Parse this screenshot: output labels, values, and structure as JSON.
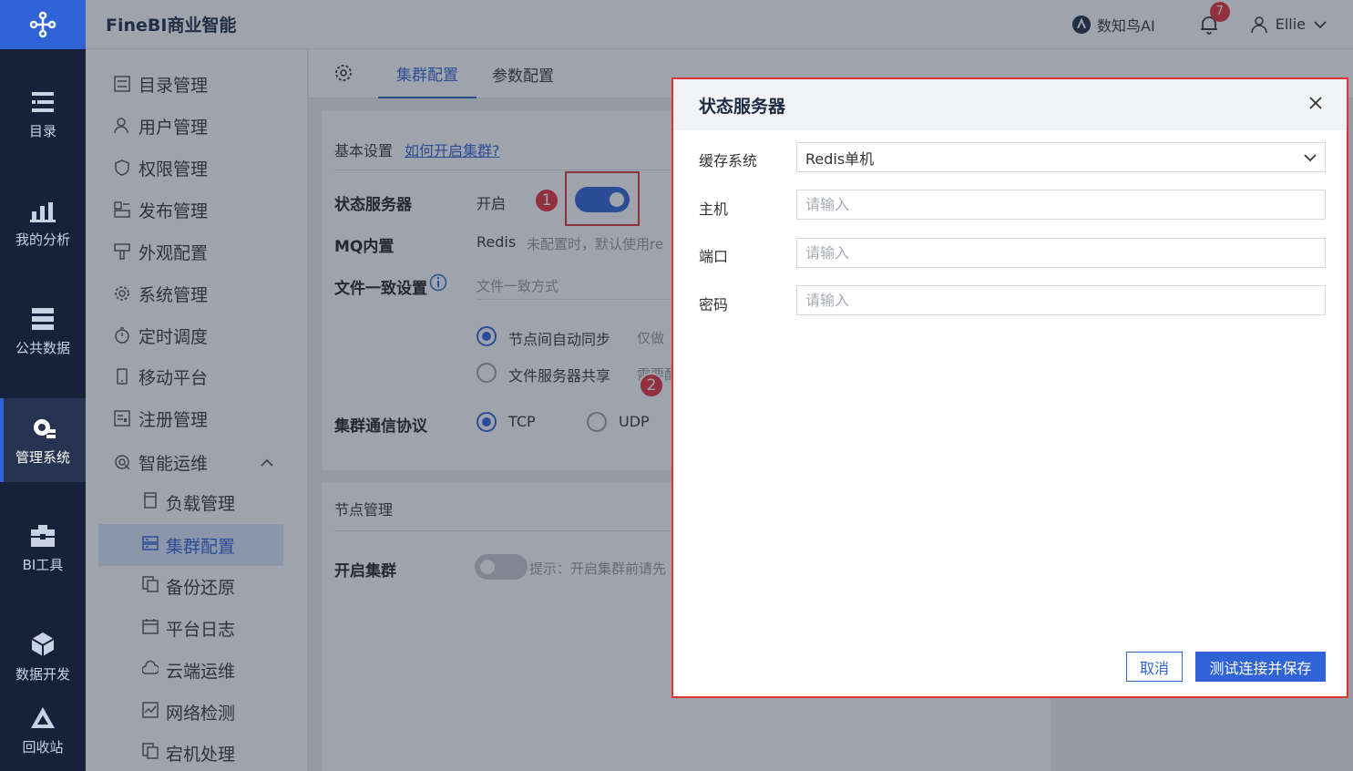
{
  "app": {
    "title": "FineBI商业智能"
  },
  "rail": {
    "items": [
      {
        "label": "目录"
      },
      {
        "label": "我的分析"
      },
      {
        "label": "公共数据"
      },
      {
        "label": "管理系统"
      },
      {
        "label": "BI工具"
      },
      {
        "label": "数据开发"
      },
      {
        "label": "回收站"
      }
    ]
  },
  "topbar": {
    "ai_label": "数知鸟AI",
    "notification_count": "7",
    "user_name": "Ellie"
  },
  "menu": {
    "items": [
      {
        "label": "目录管理"
      },
      {
        "label": "用户管理"
      },
      {
        "label": "权限管理"
      },
      {
        "label": "发布管理"
      },
      {
        "label": "外观配置"
      },
      {
        "label": "系统管理"
      },
      {
        "label": "定时调度"
      },
      {
        "label": "移动平台"
      },
      {
        "label": "注册管理"
      },
      {
        "label": "智能运维"
      }
    ],
    "sub_items": [
      {
        "label": "负载管理"
      },
      {
        "label": "集群配置"
      },
      {
        "label": "备份还原"
      },
      {
        "label": "平台日志"
      },
      {
        "label": "云端运维"
      },
      {
        "label": "网络检测"
      },
      {
        "label": "宕机处理"
      }
    ]
  },
  "tabs": [
    {
      "label": "集群配置"
    },
    {
      "label": "参数配置"
    }
  ],
  "basic": {
    "section_title": "基本设置",
    "help_link": "如何开启集群?",
    "state_server_label": "状态服务器",
    "state_server_value": "开启",
    "mq_label": "MQ内置",
    "mq_value": "Redis",
    "mq_hint": "未配置时，默认使用re",
    "file_label": "文件一致设置",
    "file_placeholder": "文件一致方式",
    "radio_sync": "节点间自动同步",
    "radio_sync_hint": "仅做",
    "radio_share": "文件服务器共享",
    "radio_share_hint": "需要配",
    "protocol_label": "集群通信协议",
    "protocol_tcp": "TCP",
    "protocol_udp": "UDP"
  },
  "nodes": {
    "section_title": "节点管理",
    "cluster_label": "开启集群",
    "cluster_hint": "提示：开启集群前请先"
  },
  "markers": {
    "one": "1",
    "two": "2"
  },
  "modal": {
    "title": "状态服务器",
    "cache_label": "缓存系统",
    "cache_value": "Redis单机",
    "host_label": "主机",
    "host_placeholder": "请输入",
    "port_label": "端口",
    "port_placeholder": "请输入",
    "password_label": "密码",
    "password_placeholder": "请输入",
    "cancel_label": "取消",
    "save_label": "测试连接并保存"
  }
}
